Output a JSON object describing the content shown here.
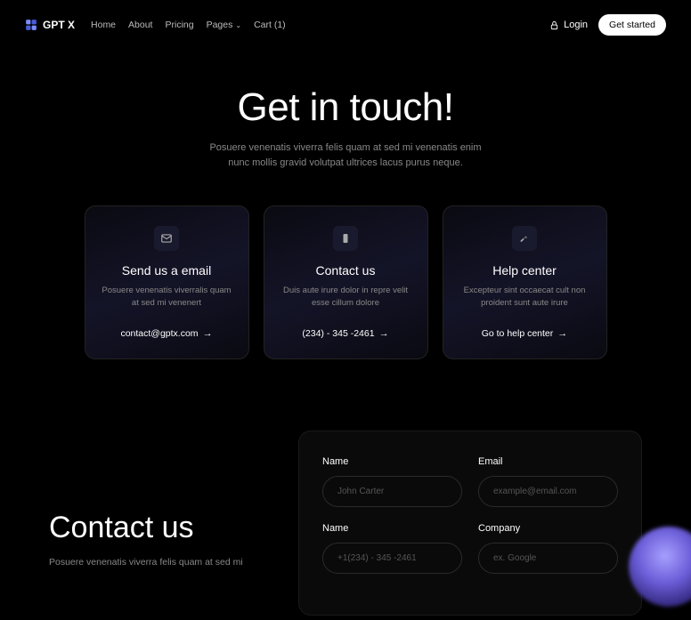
{
  "header": {
    "logo": "GPT X",
    "nav": {
      "home": "Home",
      "about": "About",
      "pricing": "Pricing",
      "pages": "Pages",
      "cart": "Cart (1)"
    },
    "login": "Login",
    "get_started": "Get started"
  },
  "hero": {
    "title": "Get in touch!",
    "subtitle1": "Posuere venenatis viverra felis quam at sed mi venenatis enim",
    "subtitle2": "nunc mollis gravid volutpat ultrices lacus purus neque."
  },
  "cards": [
    {
      "title": "Send us a email",
      "desc": "Posuere venenatis viverralis quam at sed mi venenert",
      "link": "contact@gptx.com"
    },
    {
      "title": "Contact us",
      "desc": "Duis aute irure dolor in repre velit esse cillum dolore",
      "link": "(234) - 345 -2461"
    },
    {
      "title": "Help center",
      "desc": "Excepteur sint occaecat cult non proident sunt aute irure",
      "link": "Go to help center"
    }
  ],
  "contact": {
    "title": "Contact us",
    "desc": "Posuere venenatis viverra felis quam at sed mi"
  },
  "form": {
    "name_label": "Name",
    "name_placeholder": "John Carter",
    "email_label": "Email",
    "email_placeholder": "example@email.com",
    "phone_label": "Name",
    "phone_placeholder": "+1(234) - 345 -2461",
    "company_label": "Company",
    "company_placeholder": "ex. Google"
  }
}
